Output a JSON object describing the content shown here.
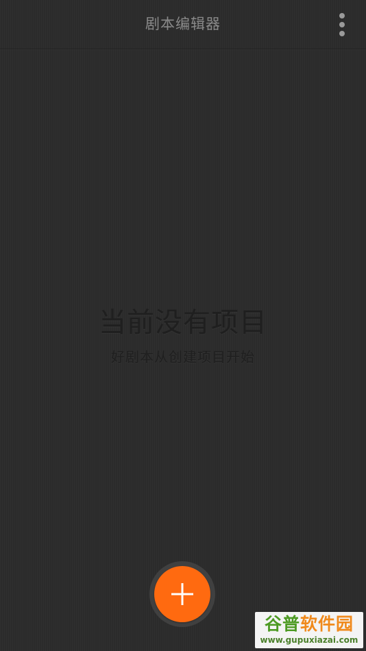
{
  "header": {
    "title": "剧本编辑器",
    "menu_icon": "more-vert-icon"
  },
  "empty_state": {
    "title": "当前没有项目",
    "subtitle": "好剧本从创建项目开始"
  },
  "fab": {
    "icon": "plus-icon",
    "color": "#ff6a10"
  },
  "watermark": {
    "brand_part1": "谷普",
    "brand_part2": "软件园",
    "url": "www.gupuxiazai.com"
  },
  "colors": {
    "background": "#2b2b2b",
    "accent": "#ff6a10"
  }
}
